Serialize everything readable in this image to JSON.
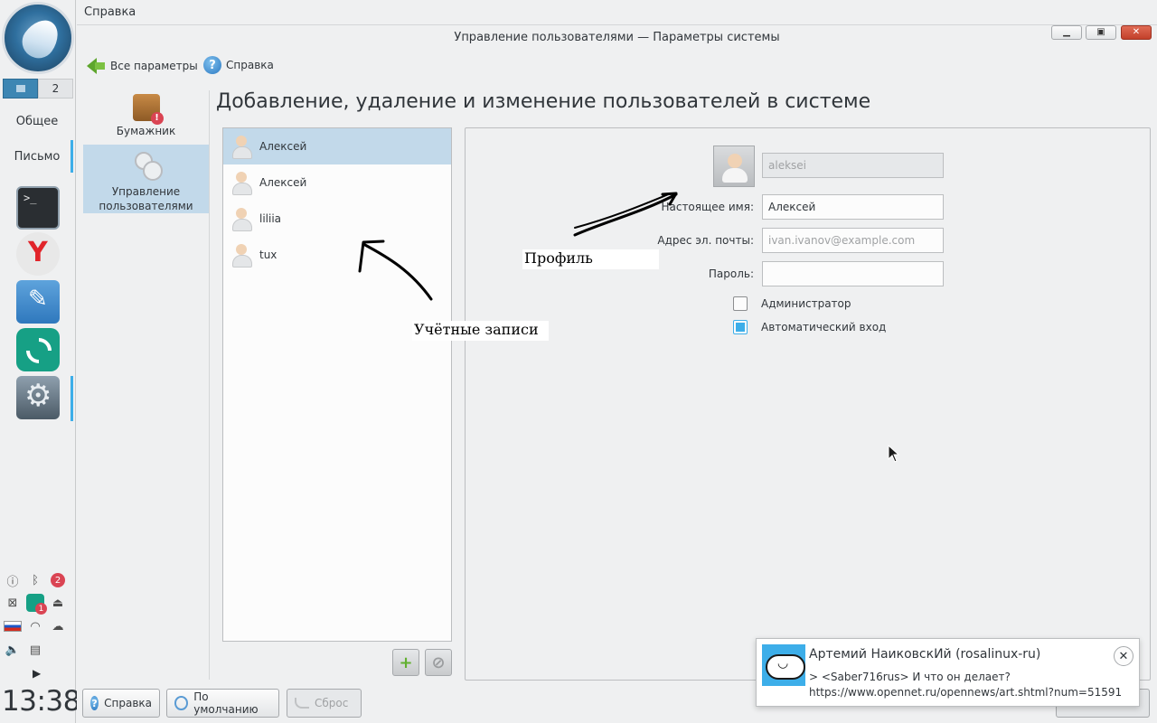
{
  "taskbar": {
    "pager": {
      "desk2": "2"
    },
    "labels": {
      "general": "Общее",
      "mail": "Письмо"
    },
    "apps": [
      "terminal-icon",
      "yandex-browser-icon",
      "text-editor-icon",
      "element-messenger-icon",
      "system-settings-icon"
    ],
    "tray": {
      "bluetooth_badge": "2",
      "element_badge": "1"
    },
    "clock": "13:38"
  },
  "menubar": {
    "help": "Справка"
  },
  "window": {
    "title": "Управление пользователями — Параметры системы",
    "buttons": {
      "minimize": "▁",
      "maximize": "▣",
      "close": "✕"
    }
  },
  "toolbar": {
    "all_settings": "Все параметры",
    "help": "Справка"
  },
  "categories": [
    {
      "label": "Бумажник"
    },
    {
      "label": "Управление пользователями"
    }
  ],
  "page": {
    "heading": "Добавление, удаление и изменение пользователей в системе"
  },
  "users": [
    {
      "name": "Алексей",
      "selected": true
    },
    {
      "name": "Алексей",
      "selected": false
    },
    {
      "name": "liliia",
      "selected": false
    },
    {
      "name": "tux",
      "selected": false
    }
  ],
  "list_buttons": {
    "add": "+",
    "remove": "⊘"
  },
  "details": {
    "username": "aleksei",
    "real_name_label": "Настоящее имя:",
    "real_name": "Алексей",
    "email_label": "Адрес эл. почты:",
    "email_placeholder": "ivan.ivanov@example.com",
    "password_label": "Пароль:",
    "password": "",
    "admin_label": "Администратор",
    "admin_checked": false,
    "autologin_label": "Автоматический вход",
    "autologin_checked": true
  },
  "bottom": {
    "help": "Справка",
    "defaults": "По умолчанию",
    "reset": "Сброс"
  },
  "annotations": {
    "accounts": "Учётные записи",
    "profile": "Профиль"
  },
  "notification": {
    "title": "Артемий НаиковскИй (rosalinux-ru)",
    "line1": "> <Saber716rus> И что он делает?",
    "line2": "https://www.opennet.ru/opennews/art.shtml?num=51591",
    "close": "✕"
  },
  "colors": {
    "accent": "#3daee9",
    "selection": "#c2d9ea",
    "background": "#eff0f1"
  }
}
